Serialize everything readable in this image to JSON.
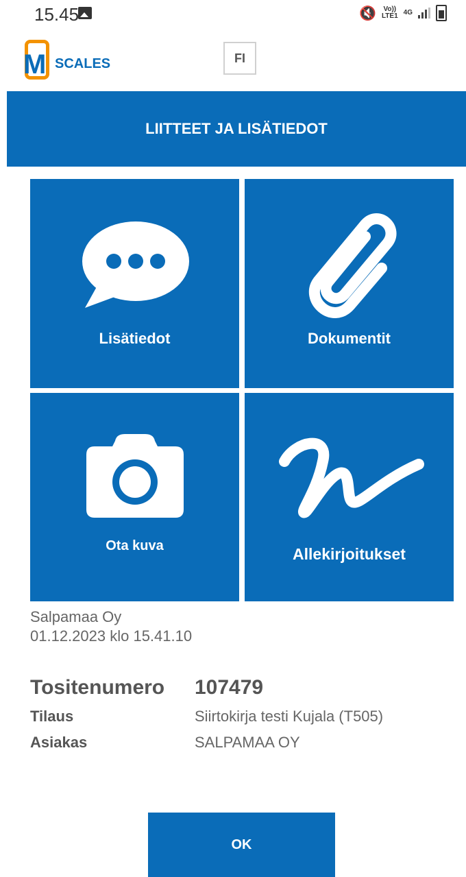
{
  "status_bar": {
    "time": "15.45",
    "network_top": "Vo))",
    "network_bottom": "LTE1",
    "gen_label": "4G"
  },
  "header": {
    "logo_text": "SCALES",
    "language": "FI"
  },
  "title": "LIITTEET JA LISÄTIEDOT",
  "tiles": [
    {
      "label": "Lisätiedot",
      "icon": "speech-bubble-icon"
    },
    {
      "label": "Dokumentit",
      "icon": "paperclip-icon"
    },
    {
      "label": "Ota kuva",
      "icon": "camera-icon"
    },
    {
      "label": "Allekirjoitukset",
      "icon": "signature-icon"
    }
  ],
  "info": {
    "company": "Salpamaa Oy",
    "datetime": "01.12.2023 klo 15.41.10"
  },
  "details": {
    "receipt_label": "Tositenumero",
    "receipt_value": "107479",
    "order_label": "Tilaus",
    "order_value": "Siirtokirja testi Kujala (T505)",
    "customer_label": "Asiakas",
    "customer_value": "SALPAMAA OY"
  },
  "ok_label": "OK",
  "colors": {
    "primary": "#0a6cb8",
    "logo_accent": "#f39200"
  }
}
